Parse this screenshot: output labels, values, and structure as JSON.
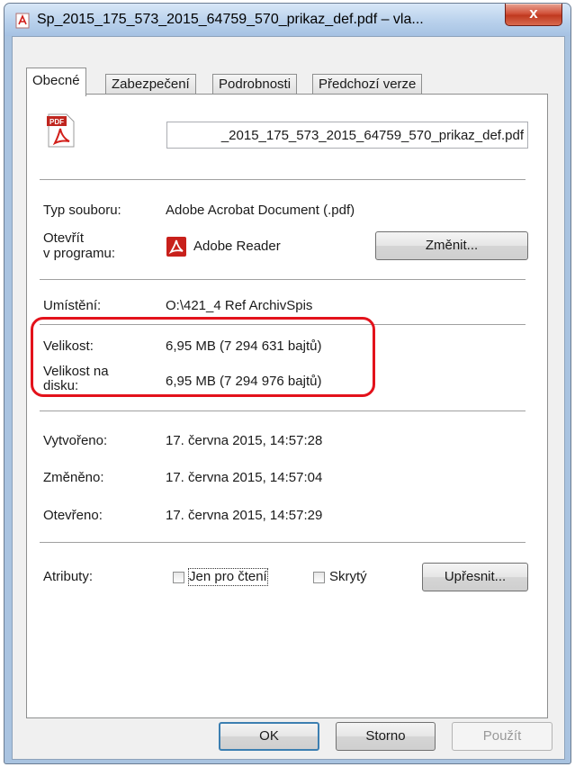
{
  "window": {
    "title": "Sp_2015_175_573_2015_64759_570_prikaz_def.pdf – vla...",
    "close_label": "x"
  },
  "tabs": [
    {
      "label": "Obecné"
    },
    {
      "label": "Zabezpečení"
    },
    {
      "label": "Podrobnosti"
    },
    {
      "label": "Předchozí verze"
    }
  ],
  "general": {
    "file_icon": "pdf-file-icon",
    "filename_value": "_2015_175_573_2015_64759_570_prikaz_def.pdf",
    "file_type_label": "Typ souboru:",
    "file_type_value": "Adobe Acrobat Document (.pdf)",
    "opens_with_label_1": "Otevřít",
    "opens_with_label_2": "v programu:",
    "opens_with_value": "Adobe Reader",
    "change_button": "Změnit...",
    "location_label": "Umístění:",
    "location_value": "O:\\421_4 Ref ArchivSpis",
    "size_label": "Velikost:",
    "size_value": "6,95 MB (7 294 631 bajtů)",
    "size_on_disk_label_1": "Velikost na",
    "size_on_disk_label_2": "disku:",
    "size_on_disk_value": "6,95 MB (7 294 976 bajtů)",
    "created_label": "Vytvořeno:",
    "created_value": "17. června 2015, 14:57:28",
    "modified_label": "Změněno:",
    "modified_value": "17. června 2015, 14:57:04",
    "accessed_label": "Otevřeno:",
    "accessed_value": "17. června 2015, 14:57:29",
    "attributes_label": "Atributy:",
    "readonly_label": "Jen pro čtení",
    "hidden_label": "Skrytý",
    "advanced_button": "Upřesnit..."
  },
  "footer": {
    "ok": "OK",
    "cancel": "Storno",
    "apply": "Použít"
  },
  "colors": {
    "highlight": "#e3121b",
    "pdf_red": "#d21f1a"
  }
}
